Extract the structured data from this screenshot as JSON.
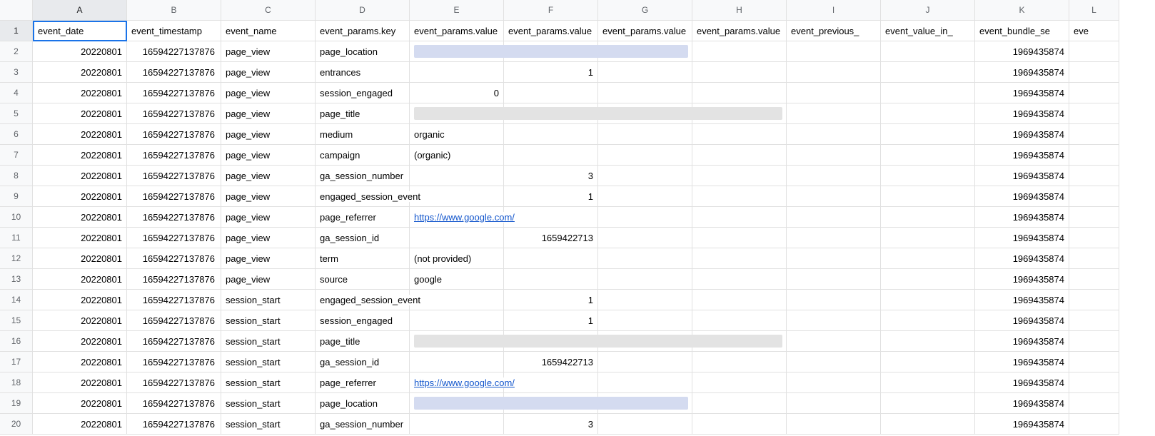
{
  "columns": [
    "A",
    "B",
    "C",
    "D",
    "E",
    "F",
    "G",
    "H",
    "I",
    "J",
    "K",
    "L"
  ],
  "selected_cell": "A1",
  "headers": {
    "A": "event_date",
    "B": "event_timestamp",
    "C": "event_name",
    "D": "event_params.key",
    "E": "event_params.value",
    "F": "event_params.value",
    "G": "event_params.value",
    "H": "event_params.value",
    "I": "event_previous_",
    "J": "event_value_in_",
    "K": "event_bundle_se",
    "L": "eve"
  },
  "rows": [
    {
      "n": 2,
      "A": "20220801",
      "B": "16594227137876",
      "C": "page_view",
      "D": "page_location",
      "E": {
        "redact": "blue",
        "span": 3
      },
      "K": "1969435874"
    },
    {
      "n": 3,
      "A": "20220801",
      "B": "16594227137876",
      "C": "page_view",
      "D": "entrances",
      "F": "1",
      "K": "1969435874"
    },
    {
      "n": 4,
      "A": "20220801",
      "B": "16594227137876",
      "C": "page_view",
      "D": "session_engaged",
      "E": "0",
      "K": "1969435874"
    },
    {
      "n": 5,
      "A": "20220801",
      "B": "16594227137876",
      "C": "page_view",
      "D": "page_title",
      "E": {
        "redact": "gray",
        "span": 4
      },
      "K": "1969435874"
    },
    {
      "n": 6,
      "A": "20220801",
      "B": "16594227137876",
      "C": "page_view",
      "D": "medium",
      "E": "organic",
      "K": "1969435874"
    },
    {
      "n": 7,
      "A": "20220801",
      "B": "16594227137876",
      "C": "page_view",
      "D": "campaign",
      "E": "(organic)",
      "K": "1969435874"
    },
    {
      "n": 8,
      "A": "20220801",
      "B": "16594227137876",
      "C": "page_view",
      "D": "ga_session_number",
      "F": "3",
      "K": "1969435874"
    },
    {
      "n": 9,
      "A": "20220801",
      "B": "16594227137876",
      "C": "page_view",
      "D": "engaged_session_event",
      "F": "1",
      "K": "1969435874"
    },
    {
      "n": 10,
      "A": "20220801",
      "B": "16594227137876",
      "C": "page_view",
      "D": "page_referrer",
      "E": {
        "link": "https://www.google.com/"
      },
      "K": "1969435874"
    },
    {
      "n": 11,
      "A": "20220801",
      "B": "16594227137876",
      "C": "page_view",
      "D": "ga_session_id",
      "F": "1659422713",
      "K": "1969435874"
    },
    {
      "n": 12,
      "A": "20220801",
      "B": "16594227137876",
      "C": "page_view",
      "D": "term",
      "E": "(not provided)",
      "K": "1969435874"
    },
    {
      "n": 13,
      "A": "20220801",
      "B": "16594227137876",
      "C": "page_view",
      "D": "source",
      "E": "google",
      "K": "1969435874"
    },
    {
      "n": 14,
      "A": "20220801",
      "B": "16594227137876",
      "C": "session_start",
      "D": "engaged_session_event",
      "F": "1",
      "K": "1969435874"
    },
    {
      "n": 15,
      "A": "20220801",
      "B": "16594227137876",
      "C": "session_start",
      "D": "session_engaged",
      "F": "1",
      "K": "1969435874"
    },
    {
      "n": 16,
      "A": "20220801",
      "B": "16594227137876",
      "C": "session_start",
      "D": "page_title",
      "E": {
        "redact": "gray",
        "span": 4
      },
      "K": "1969435874"
    },
    {
      "n": 17,
      "A": "20220801",
      "B": "16594227137876",
      "C": "session_start",
      "D": "ga_session_id",
      "F": "1659422713",
      "K": "1969435874"
    },
    {
      "n": 18,
      "A": "20220801",
      "B": "16594227137876",
      "C": "session_start",
      "D": "page_referrer",
      "E": {
        "link": "https://www.google.com/"
      },
      "K": "1969435874"
    },
    {
      "n": 19,
      "A": "20220801",
      "B": "16594227137876",
      "C": "session_start",
      "D": "page_location",
      "E": {
        "redact": "blue",
        "span": 3
      },
      "K": "1969435874"
    },
    {
      "n": 20,
      "A": "20220801",
      "B": "16594227137876",
      "C": "session_start",
      "D": "ga_session_number",
      "F": "3",
      "K": "1969435874"
    }
  ]
}
